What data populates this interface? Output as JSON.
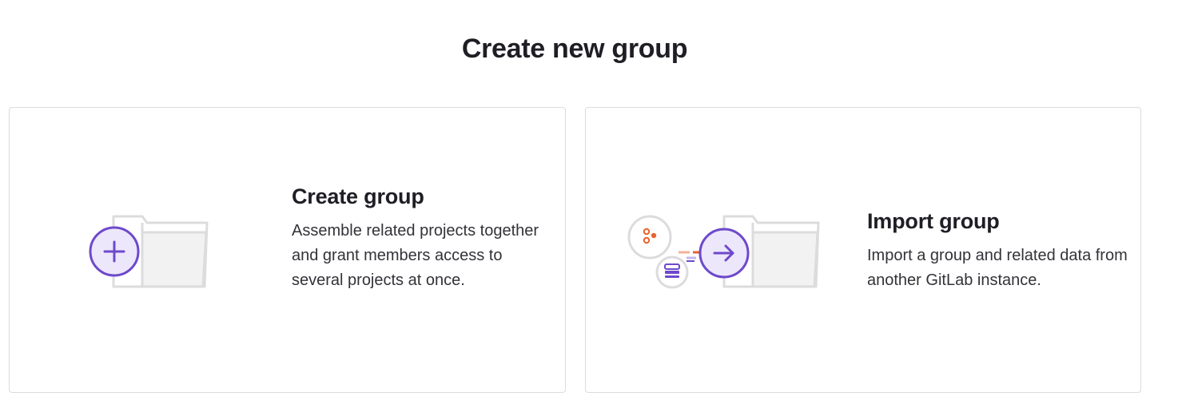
{
  "page": {
    "title": "Create new group"
  },
  "cards": [
    {
      "title": "Create group",
      "description": "Assemble related projects together and grant members access to several projects at once.",
      "icon": "folder-plus-icon"
    },
    {
      "title": "Import group",
      "description": "Import a group and related data from another GitLab instance.",
      "icon": "folder-import-icon"
    }
  ],
  "colors": {
    "accent_purple": "#6e49cb",
    "accent_purple_light": "#ece7fb",
    "folder_gray": "#dcdcde",
    "folder_fill": "#f4f4f4",
    "orange": "#e9632b"
  }
}
